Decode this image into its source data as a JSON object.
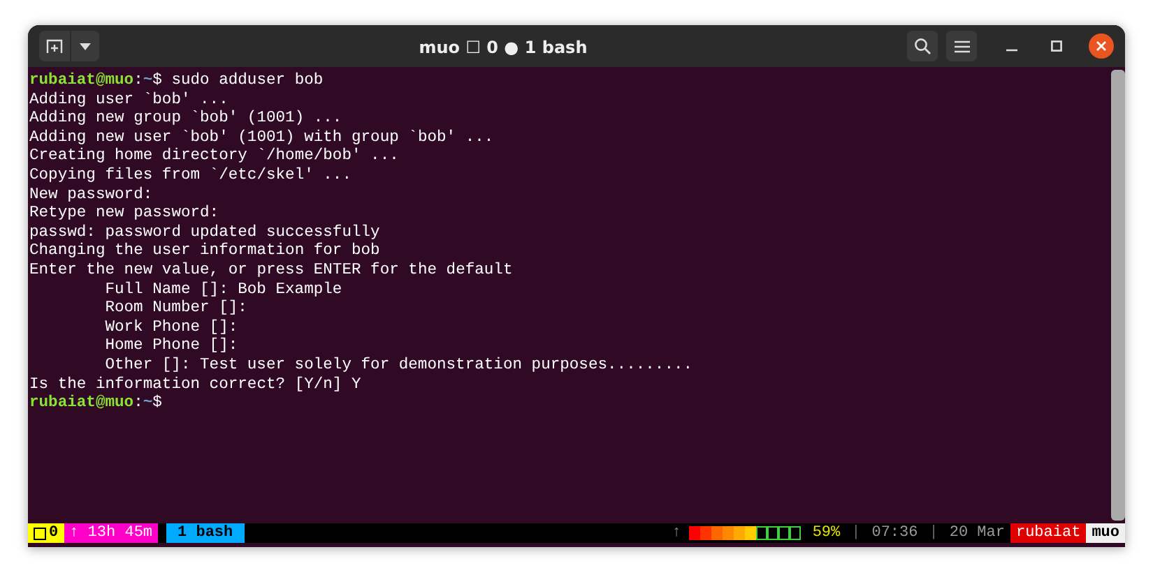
{
  "window": {
    "title": "muo ☐ 0 ● 1 bash"
  },
  "terminal": {
    "lines": [
      {
        "kind": "prompt",
        "user": "rubaiat@muo",
        "sep": ":",
        "dir": "~",
        "symbol": "$",
        "command": "sudo adduser bob"
      },
      {
        "kind": "output",
        "text": "Adding user `bob' ..."
      },
      {
        "kind": "output",
        "text": "Adding new group `bob' (1001) ..."
      },
      {
        "kind": "output",
        "text": "Adding new user `bob' (1001) with group `bob' ..."
      },
      {
        "kind": "output",
        "text": "Creating home directory `/home/bob' ..."
      },
      {
        "kind": "output",
        "text": "Copying files from `/etc/skel' ..."
      },
      {
        "kind": "output",
        "text": "New password:"
      },
      {
        "kind": "output",
        "text": "Retype new password:"
      },
      {
        "kind": "output",
        "text": "passwd: password updated successfully"
      },
      {
        "kind": "output",
        "text": "Changing the user information for bob"
      },
      {
        "kind": "output",
        "text": "Enter the new value, or press ENTER for the default"
      },
      {
        "kind": "indented",
        "text": "Full Name []: Bob Example"
      },
      {
        "kind": "indented",
        "text": "Room Number []:"
      },
      {
        "kind": "indented",
        "text": "Work Phone []:"
      },
      {
        "kind": "indented",
        "text": "Home Phone []:"
      },
      {
        "kind": "indented",
        "text": "Other []: Test user solely for demonstration purposes........."
      },
      {
        "kind": "output",
        "text": "Is the information correct? [Y/n] Y"
      },
      {
        "kind": "prompt",
        "user": "rubaiat@muo",
        "sep": ":",
        "dir": "~",
        "symbol": "$"
      }
    ]
  },
  "status_bar": {
    "left": [
      {
        "kind": "session",
        "text": "0"
      },
      {
        "kind": "uptime",
        "text": "↑ 13h 45m"
      },
      {
        "kind": "window",
        "text": "1 bash"
      }
    ],
    "right": [
      {
        "kind": "arrow",
        "text": "↑"
      },
      {
        "kind": "meter",
        "level": 0.6
      },
      {
        "kind": "percent",
        "text": "59%"
      },
      {
        "kind": "sep",
        "text": "|"
      },
      {
        "kind": "time",
        "text": "07:36"
      },
      {
        "kind": "sep",
        "text": "|"
      },
      {
        "kind": "time",
        "text": "20 Mar"
      },
      {
        "kind": "user",
        "text": "rubaiat"
      },
      {
        "kind": "host",
        "text": "muo"
      }
    ]
  }
}
